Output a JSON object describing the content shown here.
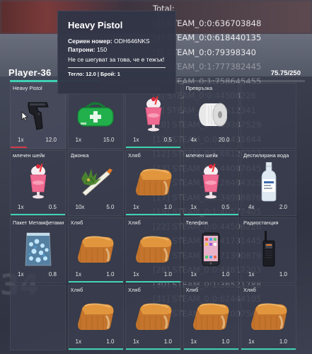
{
  "console": {
    "total_label": "Total:",
    "lines": [
      {
        "text": "[2] STEAM_0:0:636703848",
        "bright": true
      },
      {
        "text": "[4] STEAM_0:0:618440135",
        "bright": true
      },
      {
        "text": "[5] STEAM_0:0:79398340",
        "bright": true
      },
      {
        "text": "[6] STEAM_0:1:777382445",
        "bright": false
      },
      {
        "text": "[7] STEAM_0:1:758645455",
        "bright": false
      },
      {
        "text": "[8] STEAM_0:0:44508226",
        "bright": false
      },
      {
        "text": "[9] STEAM_0:1:35612341",
        "bright": false
      },
      {
        "text": "[10] STEAM_0:0:69387529",
        "bright": false
      },
      {
        "text": "[11] STEAM_0:0:81431644",
        "bright": false
      },
      {
        "text": "[12] STEAM_0:1:66120223",
        "bright": false
      },
      {
        "text": "[13] STEAM_0:1:44087645",
        "bright": false
      },
      {
        "text": "[15] STEAM_0:0:28484325",
        "bright": false
      },
      {
        "text": "[17] STEAM_0:0:34988876",
        "bright": false
      },
      {
        "text": "[19] STEAM_0:1:40577405",
        "bright": false
      },
      {
        "text": "[22] STEAM_0:0:44508226",
        "bright": false
      },
      {
        "text": "[24] STEAM_0:0:41731445",
        "bright": false
      },
      {
        "text": "[26] STEAM_0:1:71390879",
        "bright": false
      },
      {
        "text": "[28] STEAM_0:0:44817203",
        "bright": false
      },
      {
        "text": "[30] STEAM_0:1:36521788",
        "bright": false
      },
      {
        "text": "[31] STEAM_0:0:62444105",
        "bright": false
      },
      {
        "text": "[32] STEAM_0:0:870075428",
        "bright": false
      }
    ]
  },
  "inventory": {
    "player_name": "Player-36",
    "weight_text": "75.75/250",
    "weight_fraction": 0.303,
    "slots": [
      {
        "label": "Heavy Pistol",
        "qty": "1x",
        "weight": "12.0",
        "icon": "pistol-icon",
        "bar": "red",
        "bar_fraction": 0.3
      },
      {
        "label": "",
        "qty": "1x",
        "weight": "15.0",
        "icon": "medkit-bag-icon",
        "bar": "none"
      },
      {
        "label": "млечен шейк",
        "qty": "1x",
        "weight": "0.5",
        "icon": "milkshake-icon",
        "bar": "teal"
      },
      {
        "label": "Превръзка",
        "qty": "4x",
        "weight": "20.0",
        "icon": "bandage-roll-icon",
        "bar": "none"
      },
      {
        "label": "",
        "qty": "",
        "weight": "",
        "icon": "",
        "bar": "none"
      },
      {
        "label": "млечен шейк",
        "qty": "1x",
        "weight": "0.5",
        "icon": "milkshake-icon",
        "bar": "teal"
      },
      {
        "label": "Джонка",
        "qty": "10x",
        "weight": "5.0",
        "icon": "joint-icon",
        "bar": "none"
      },
      {
        "label": "Хляб",
        "qty": "1x",
        "weight": "1.0",
        "icon": "bread-icon",
        "bar": "teal"
      },
      {
        "label": "млечен шейк",
        "qty": "1x",
        "weight": "0.5",
        "icon": "milkshake-icon",
        "bar": "teal"
      },
      {
        "label": "Дестилирана вода",
        "qty": "4x",
        "weight": "2.0",
        "icon": "water-bottle-icon",
        "bar": "none"
      },
      {
        "label": "Пакет Метамфетамин",
        "qty": "1x",
        "weight": "0.8",
        "icon": "meth-bag-icon",
        "bar": "none"
      },
      {
        "label": "Хляб",
        "qty": "1x",
        "weight": "1.0",
        "icon": "bread-icon",
        "bar": "teal"
      },
      {
        "label": "Хляб",
        "qty": "1x",
        "weight": "1.0",
        "icon": "bread-icon",
        "bar": "teal"
      },
      {
        "label": "Телефон",
        "qty": "1x",
        "weight": "1.0",
        "icon": "phone-icon",
        "bar": "none"
      },
      {
        "label": "Радиостанция",
        "qty": "1x",
        "weight": "1.0",
        "icon": "radio-icon",
        "bar": "none"
      },
      {
        "label": "",
        "qty": "",
        "weight": "",
        "icon": "",
        "bar": "none"
      },
      {
        "label": "Хляб",
        "qty": "1x",
        "weight": "1.0",
        "icon": "bread-icon",
        "bar": "teal"
      },
      {
        "label": "Хляб",
        "qty": "1x",
        "weight": "1.0",
        "icon": "bread-icon",
        "bar": "teal"
      },
      {
        "label": "Хляб",
        "qty": "1x",
        "weight": "1.0",
        "icon": "bread-icon",
        "bar": "teal"
      },
      {
        "label": "Хляб",
        "qty": "1x",
        "weight": "1.0",
        "icon": "bread-icon",
        "bar": "teal"
      }
    ]
  },
  "tooltip": {
    "title": "Heavy Pistol",
    "serial_label": "Сериен номер:",
    "serial_value": "ODH646NKS",
    "ammo_label": "Патрони:",
    "ammo_value": "150",
    "description": "Не се шегуват за това, че е тежък!",
    "footer": "Тегло: 12.0 | Брой: 1"
  },
  "background": {
    "faded_number": "34"
  },
  "colors": {
    "accent": "#3fd1b3",
    "durability_low": "#d23a4a",
    "slot_bg": "#3a3e4e"
  }
}
